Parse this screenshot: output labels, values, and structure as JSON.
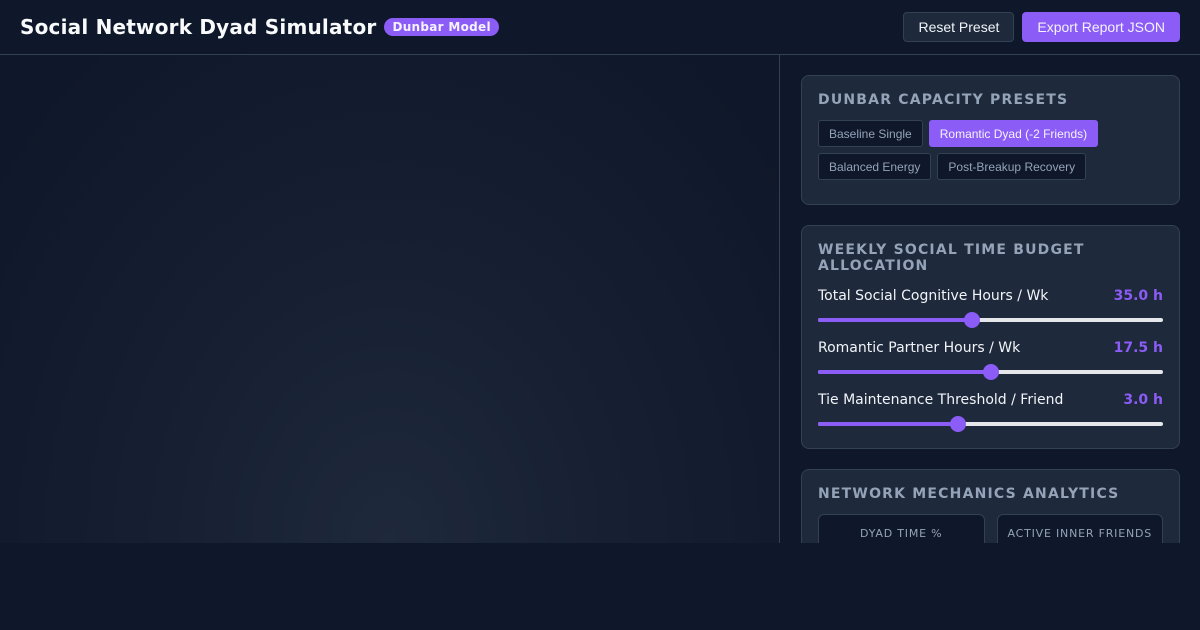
{
  "header": {
    "title": "Social Network Dyad Simulator",
    "badge": "Dunbar Model",
    "reset_label": "Reset Preset",
    "export_label": "Export Report JSON"
  },
  "presets": {
    "title": "Dunbar Capacity Presets",
    "items": [
      {
        "label": "Baseline Single",
        "active": false
      },
      {
        "label": "Romantic Dyad (-2 Friends)",
        "active": true
      },
      {
        "label": "Balanced Energy",
        "active": false
      },
      {
        "label": "Post-Breakup Recovery",
        "active": false
      }
    ]
  },
  "budget": {
    "title": "Weekly Social Time Budget Allocation",
    "sliders": [
      {
        "label": "Total Social Cognitive Hours / Wk",
        "value": "35.0 h",
        "fraction": 0.446
      },
      {
        "label": "Romantic Partner Hours / Wk",
        "value": "17.5 h",
        "fraction": 0.5
      },
      {
        "label": "Tie Maintenance Threshold / Friend",
        "value": "3.0 h",
        "fraction": 0.406
      }
    ]
  },
  "analytics": {
    "title": "Network Mechanics Analytics",
    "metrics": [
      {
        "label": "Dyad Time %"
      },
      {
        "label": "Active Inner Friends"
      }
    ]
  },
  "colors": {
    "accent": "#8b5cf6",
    "background": "#0f172a",
    "card": "#1e293b",
    "border": "#334155"
  }
}
